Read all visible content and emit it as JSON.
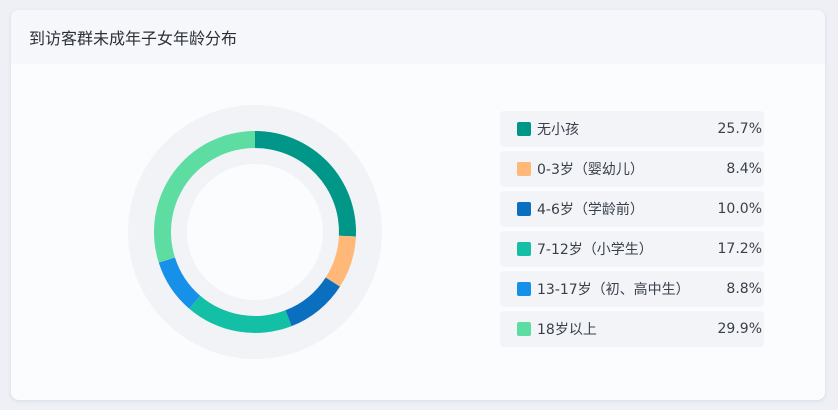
{
  "card": {
    "title": "到访客群未成年子女年龄分布"
  },
  "chart_data": {
    "type": "pie",
    "subtype": "donut",
    "title": "到访客群未成年子女年龄分布",
    "categories": [
      "无小孩",
      "0-3岁（婴幼儿）",
      "4-6岁（学龄前）",
      "7-12岁（小学生）",
      "13-17岁（初、高中生）",
      "18岁以上"
    ],
    "values": [
      25.7,
      8.4,
      10.0,
      17.2,
      8.8,
      29.9
    ],
    "value_labels": [
      "25.7%",
      "8.4%",
      "10.0%",
      "17.2%",
      "8.8%",
      "29.9%"
    ],
    "colors": [
      "#009688",
      "#ffb878",
      "#0a6fbf",
      "#13bfa5",
      "#1690e8",
      "#5edda2"
    ],
    "track_color": "#f2f3f6",
    "legend_position": "right"
  }
}
